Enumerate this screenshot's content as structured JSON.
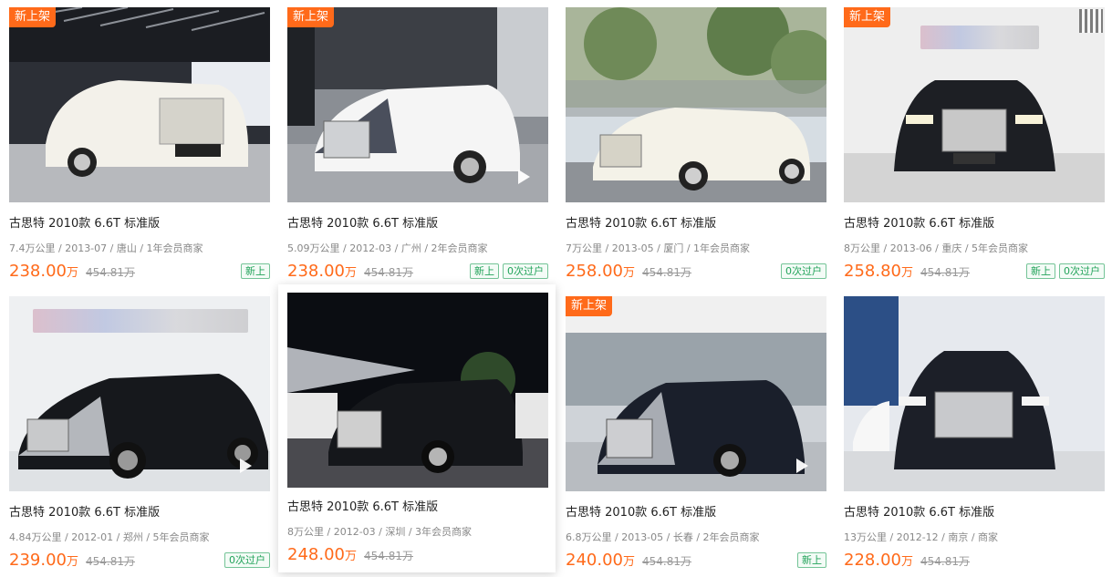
{
  "listings": [
    {
      "title": "古思特 2010款 6.6T 标准版",
      "meta": "7.4万公里 / 2013-07 / 唐山 / 1年会员商家",
      "price": "238.00",
      "unit": "万",
      "orig": "454.81万",
      "badge": "新上架",
      "tags": [
        "新上"
      ],
      "video": false
    },
    {
      "title": "古思特 2010款 6.6T 标准版",
      "meta": "5.09万公里 / 2012-03 / 广州 / 2年会员商家",
      "price": "238.00",
      "unit": "万",
      "orig": "454.81万",
      "badge": "新上架",
      "tags": [
        "新上",
        "0次过户"
      ],
      "video": true
    },
    {
      "title": "古思特 2010款 6.6T 标准版",
      "meta": "7万公里 / 2013-05 / 厦门 / 1年会员商家",
      "price": "258.00",
      "unit": "万",
      "orig": "454.81万",
      "badge": "",
      "tags": [
        "0次过户"
      ],
      "video": false
    },
    {
      "title": "古思特 2010款 6.6T 标准版",
      "meta": "8万公里 / 2013-06 / 重庆 / 5年会员商家",
      "price": "258.80",
      "unit": "万",
      "orig": "454.81万",
      "badge": "新上架",
      "tags": [
        "新上",
        "0次过户"
      ],
      "video": false
    },
    {
      "title": "古思特 2010款 6.6T 标准版",
      "meta": "4.84万公里 / 2012-01 / 郑州 / 5年会员商家",
      "price": "239.00",
      "unit": "万",
      "orig": "454.81万",
      "badge": "",
      "tags": [
        "0次过户"
      ],
      "video": true
    },
    {
      "title": "古思特 2010款 6.6T 标准版",
      "meta": "8万公里 / 2012-03 / 深圳 / 3年会员商家",
      "price": "248.00",
      "unit": "万",
      "orig": "454.81万",
      "badge": "",
      "tags": [],
      "video": false
    },
    {
      "title": "古思特 2010款 6.6T 标准版",
      "meta": "6.8万公里 / 2013-05 / 长春 / 2年会员商家",
      "price": "240.00",
      "unit": "万",
      "orig": "454.81万",
      "badge": "新上架",
      "tags": [
        "新上"
      ],
      "video": true
    },
    {
      "title": "古思特 2010款 6.6T 标准版",
      "meta": "13万公里 / 2012-12 / 南京 / 商家",
      "price": "228.00",
      "unit": "万",
      "orig": "454.81万",
      "badge": "",
      "tags": [],
      "video": false
    }
  ]
}
